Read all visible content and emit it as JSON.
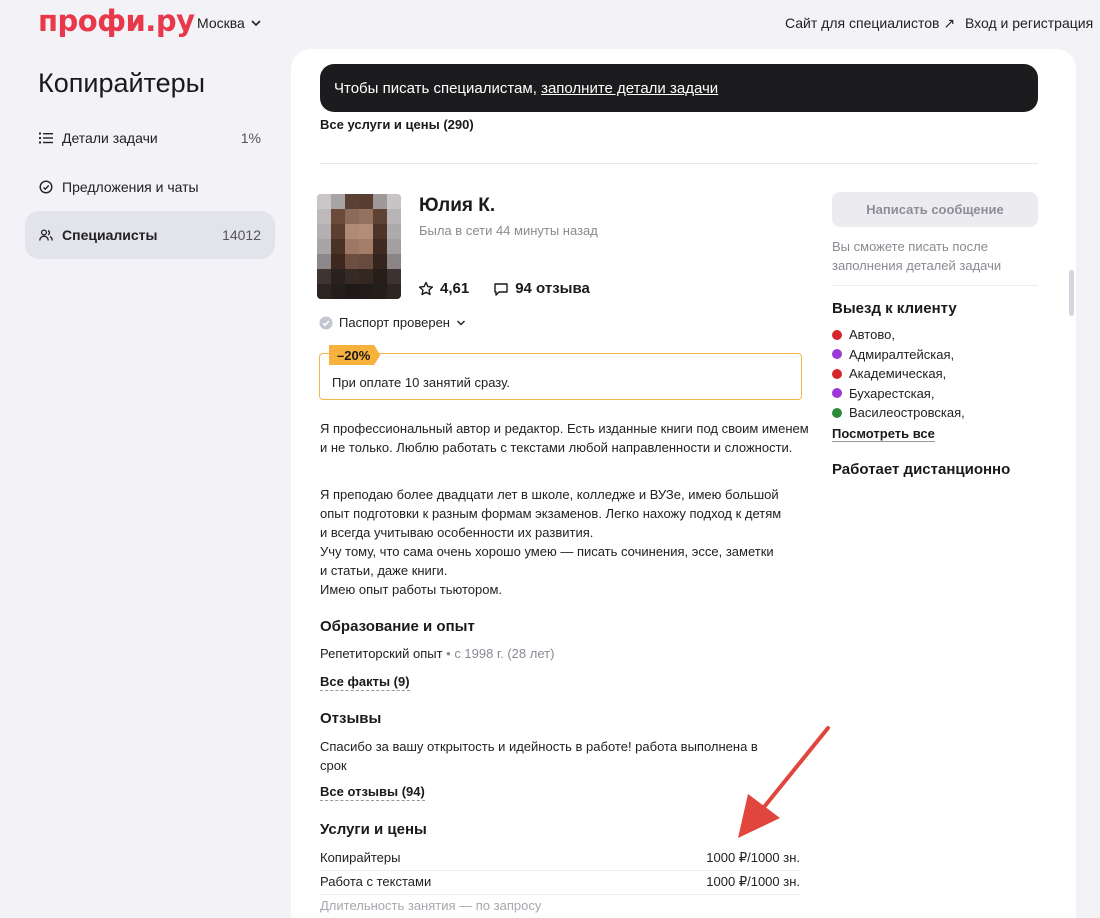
{
  "header": {
    "logo": "профи.ру",
    "city": "Москва",
    "for_specialists": "Сайт для специалистов ↗",
    "login": "Вход и регистрация"
  },
  "sidebar": {
    "title": "Копирайтеры",
    "items": [
      {
        "label": "Детали задачи",
        "count": "1%",
        "icon": "list-icon",
        "active": false
      },
      {
        "label": "Предложения и чаты",
        "count": "",
        "icon": "chat-icon",
        "active": false
      },
      {
        "label": "Специалисты",
        "count": "14012",
        "icon": "people-icon",
        "active": true
      }
    ]
  },
  "banner": {
    "prefix": "Чтобы писать специалистам, ",
    "link": "заполните детали задачи"
  },
  "all_services": "Все услуги и цены (290)",
  "profile": {
    "name": "Юлия К.",
    "last_seen": "Была в сети 44 минуты назад",
    "rating": "4,61",
    "reviews": "94 отзыва",
    "passport": "Паспорт проверен",
    "discount_tag": "–20%",
    "discount_text": "При оплате 10 занятий сразу.",
    "about_1": "Я профессиональный автор и редактор. Есть изданные книги под своим именем и не только. Люблю работать с текстами любой направленности и сложности.",
    "about_2_lines": [
      "Я преподаю более двадцати лет в школе, колледже и ВУЗе, имею большой",
      "опыт подготовки к разным формам экзаменов. Легко нахожу подход к детям",
      "и всегда учитываю особенности их развития.",
      "Учу тому, что сама очень хорошо умею — писать сочинения, эссе, заметки",
      "и статьи, даже книги.",
      "Имею опыт работы тьютором."
    ]
  },
  "education": {
    "title": "Образование и опыт",
    "line": "Репетиторский опыт",
    "since": " • с 1998 г. (28 лет)",
    "all_facts": "Все факты (9)"
  },
  "reviews": {
    "title": "Отзывы",
    "text_lines": [
      "Спасибо за вашу открытость и идейность в работе! работа выполнена в",
      "срок"
    ],
    "all": "Все отзывы (94)"
  },
  "services": {
    "title": "Услуги и цены",
    "rows": [
      {
        "name": "Копирайтеры",
        "price": "1000 ₽/1000 зн."
      },
      {
        "name": "Работа с текстами",
        "price": "1000 ₽/1000 зн."
      }
    ],
    "duration": "Длительность занятия — по запросу"
  },
  "contact": {
    "button": "Написать сообщение",
    "hint": "Вы сможете писать после заполнения деталей задачи"
  },
  "visit": {
    "title": "Выезд к клиенту",
    "stations": [
      {
        "name": "Автово,",
        "color": "#d6262c"
      },
      {
        "name": "Адмиралтейская,",
        "color": "#9b3ad6"
      },
      {
        "name": "Академическая,",
        "color": "#d6262c"
      },
      {
        "name": "Бухарестская,",
        "color": "#9b3ad6"
      },
      {
        "name": "Василеостровская,",
        "color": "#2e8b3a"
      }
    ],
    "see_all": "Посмотреть все",
    "remote": "Работает дистанционно"
  },
  "colors": {
    "brand": "#e8384a",
    "discount": "#f6b23c",
    "annotation_arrow": "#e0463d"
  }
}
